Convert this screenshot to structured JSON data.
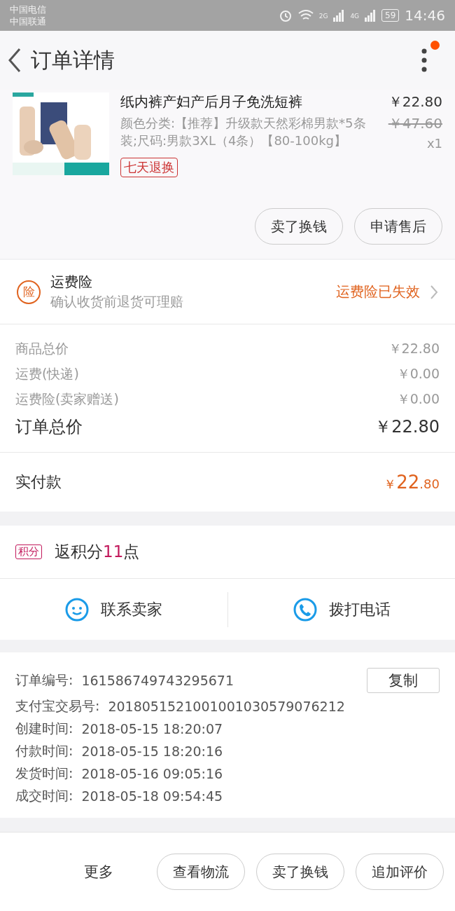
{
  "status_bar": {
    "carriers": [
      "中国电信",
      "中国联通"
    ],
    "net_labels": [
      "2G",
      "4G"
    ],
    "battery": "59",
    "time": "14:46"
  },
  "header": {
    "title": "订单详情",
    "notification_dot": true
  },
  "product": {
    "kind": "picture",
    "title": "纸内裤产妇产后月子免洗短裤",
    "price": "￥22.80",
    "original_price": "￥47.60",
    "quantity": "x1",
    "spec": "颜色分类:【推荐】升级款天然彩棉男款*5条装;尺码:男款3XL（4条）【80-100kg】",
    "tag": "七天退换",
    "buttons": [
      "卖了换钱",
      "申请售后"
    ]
  },
  "insurance": {
    "badge": "险",
    "title": "运费险",
    "subtitle": "确认收货前退货可理赔",
    "status": "运费险已失效"
  },
  "price_lines": [
    {
      "label": "商品总价",
      "value": "￥22.80",
      "kind": "minor"
    },
    {
      "label": "运费(快递)",
      "value": "￥0.00",
      "kind": "minor"
    },
    {
      "label": "运费险(卖家赠送)",
      "value": "￥0.00",
      "kind": "minor"
    },
    {
      "label": "订单总价",
      "value": "￥22.80",
      "kind": "total"
    }
  ],
  "paid": {
    "label": "实付款",
    "currency": "￥",
    "integer": "22",
    "decimal": ".80"
  },
  "points": {
    "badge": "积分",
    "prefix": "返积分",
    "amount": "11",
    "suffix": "点"
  },
  "contact": [
    {
      "label": "联系卖家",
      "kind": "chat"
    },
    {
      "label": "拨打电话",
      "kind": "phone"
    }
  ],
  "order_info": {
    "copy_button": "复制",
    "rows": [
      {
        "label": "订单编号:",
        "value": "161586749743295671"
      },
      {
        "label": "支付宝交易号:",
        "value": "2018051521001001030579076212"
      },
      {
        "label": "创建时间:",
        "value": "2018-05-15 18:20:07"
      },
      {
        "label": "付款时间:",
        "value": "2018-05-15 18:20:16"
      },
      {
        "label": "发货时间:",
        "value": "2018-05-16 09:05:16"
      },
      {
        "label": "成交时间:",
        "value": "2018-05-18 09:54:45"
      }
    ]
  },
  "bottom_bar": {
    "more": "更多",
    "buttons": [
      "查看物流",
      "卖了换钱",
      "追加评价"
    ]
  }
}
